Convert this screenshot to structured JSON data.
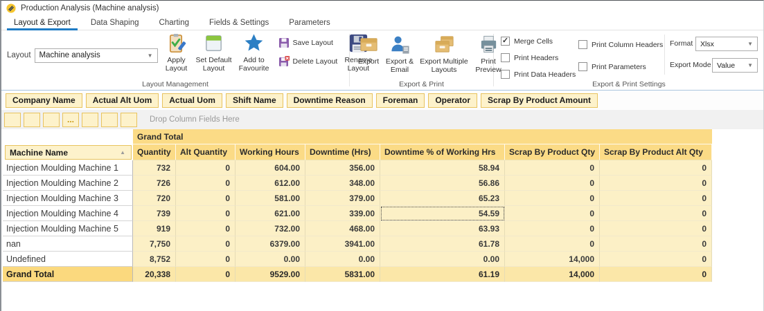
{
  "window": {
    "title": "Production Analysis (Machine analysis)"
  },
  "tabs": [
    {
      "label": "Layout & Export",
      "active": true
    },
    {
      "label": "Data Shaping",
      "active": false
    },
    {
      "label": "Charting",
      "active": false
    },
    {
      "label": "Fields & Settings",
      "active": false
    },
    {
      "label": "Parameters",
      "active": false
    }
  ],
  "ribbon": {
    "layout_label": "Layout",
    "layout_value": "Machine analysis",
    "layout_management": {
      "group_label": "Layout Management",
      "apply_layout": "Apply Layout",
      "set_default_layout": "Set Default Layout",
      "add_to_favourite": "Add to Favourite",
      "save_layout": "Save Layout",
      "delete_layout": "Delete Layout",
      "rename_layout": "Rename Layout"
    },
    "export_print": {
      "group_label": "Export & Print",
      "export": "Export",
      "export_email": "Export & Email",
      "export_multiple": "Export Multiple Layouts",
      "print_preview": "Print Preview"
    },
    "export_print_settings": {
      "group_label": "Export & Print Settings",
      "merge_cells": "Merge Cells",
      "print_headers": "Print Headers",
      "print_data_headers": "Print Data Headers",
      "print_column_headers": "Print Column Headers",
      "print_parameters": "Print Parameters",
      "format_label": "Format",
      "format_value": "Xlsx",
      "export_mode_label": "Export Mode",
      "export_mode_value": "Value"
    }
  },
  "filter_fields": [
    "Company Name",
    "Actual Alt Uom",
    "Actual Uom",
    "Shift Name",
    "Downtime Reason",
    "Foreman",
    "Operator",
    "Scrap By Product Amount"
  ],
  "column_area": {
    "drop_hint": "Drop Column Fields Here",
    "ellipsis": "..."
  },
  "icons": {
    "dropdown_arrow": "▼",
    "sort_asc": "▲",
    "check": "✓"
  },
  "pivot": {
    "row_field": "Machine Name",
    "banner": "Grand Total",
    "columns": [
      "Quantity",
      "Alt Quantity",
      "Working Hours",
      "Downtime (Hrs)",
      "Downtime % of Working Hrs",
      "Scrap By Product Qty",
      "Scrap By Product Alt Qty"
    ],
    "rows": [
      {
        "name": "Injection Moulding Machine 1",
        "values": [
          "732",
          "0",
          "604.00",
          "356.00",
          "58.94",
          "0",
          "0"
        ]
      },
      {
        "name": "Injection Moulding Machine 2",
        "values": [
          "726",
          "0",
          "612.00",
          "348.00",
          "56.86",
          "0",
          "0"
        ]
      },
      {
        "name": "Injection Moulding Machine 3",
        "values": [
          "720",
          "0",
          "581.00",
          "379.00",
          "65.23",
          "0",
          "0"
        ]
      },
      {
        "name": "Injection Moulding Machine 4",
        "values": [
          "739",
          "0",
          "621.00",
          "339.00",
          "54.59",
          "0",
          "0"
        ]
      },
      {
        "name": "Injection Moulding Machine 5",
        "values": [
          "919",
          "0",
          "732.00",
          "468.00",
          "63.93",
          "0",
          "0"
        ]
      },
      {
        "name": "nan",
        "values": [
          "7,750",
          "0",
          "6379.00",
          "3941.00",
          "61.78",
          "0",
          "0"
        ]
      },
      {
        "name": "Undefined",
        "values": [
          "8,752",
          "0",
          "0.00",
          "0.00",
          "0.00",
          "14,000",
          "0"
        ]
      },
      {
        "name": "Grand Total",
        "values": [
          "20,338",
          "0",
          "9529.00",
          "5831.00",
          "61.19",
          "14,000",
          "0"
        ]
      }
    ]
  },
  "colors": {
    "accent_blue": "#1e7bc4",
    "header_gold": "#fbdb86",
    "cell_yellow": "#fcf0c6",
    "field_cream": "#fdf2cb",
    "gold_border": "#e8c35e"
  }
}
